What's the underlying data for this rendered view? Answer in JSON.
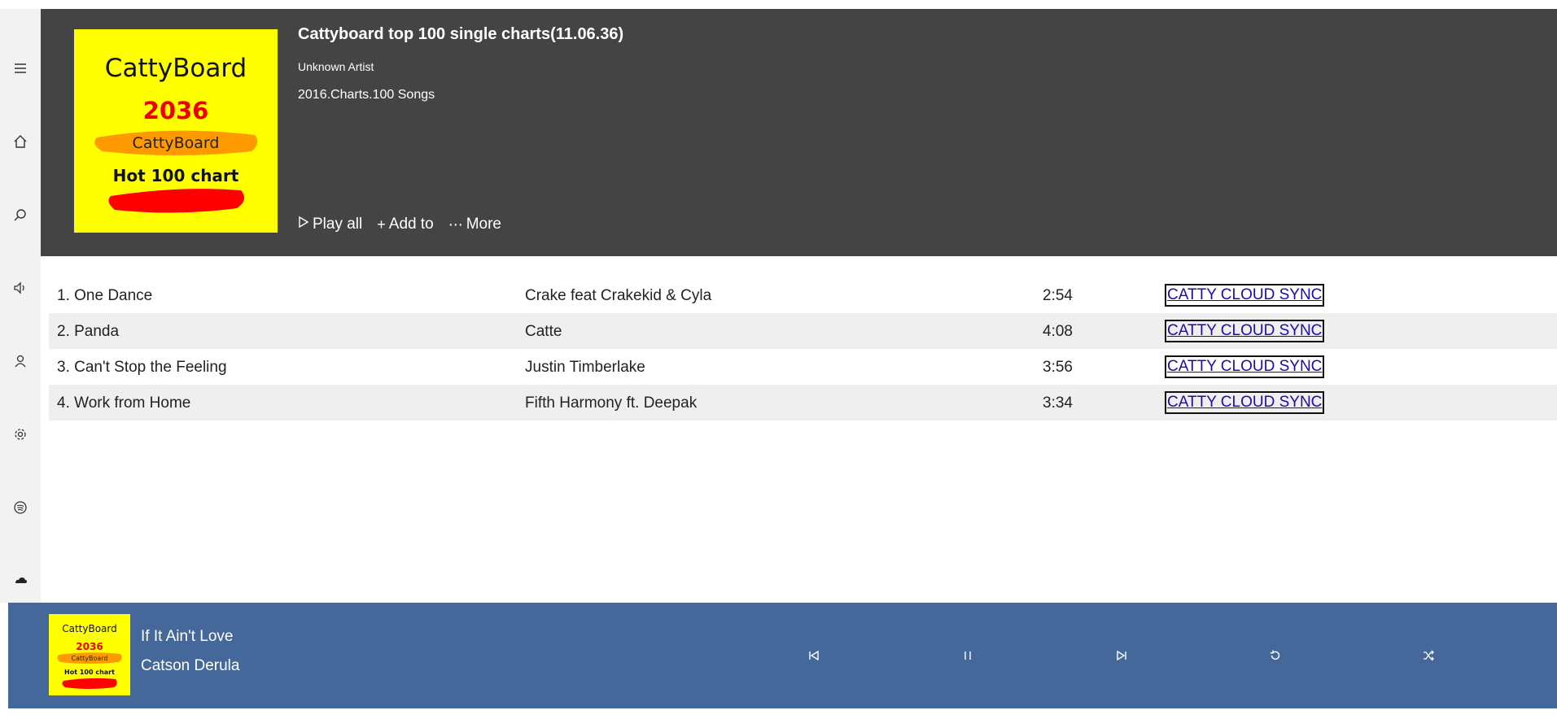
{
  "sidebar": {
    "items": [
      {
        "name": "menu-icon"
      },
      {
        "name": "home-icon"
      },
      {
        "name": "search-icon"
      },
      {
        "name": "speaker-icon"
      },
      {
        "name": "user-icon"
      },
      {
        "name": "gear-icon"
      },
      {
        "name": "spotify-icon"
      },
      {
        "name": "soundcloud-icon"
      }
    ]
  },
  "album": {
    "title": "Cattyboard top 100 single charts(11.06.36)",
    "artist": "Unknown Artist",
    "subtitle": "2016.Charts.100 Songs",
    "art": {
      "brand": "CattyBoard",
      "year": "2036",
      "brand2": "CattyBoard",
      "label": "Hot 100 chart"
    },
    "actions": {
      "play_all": "Play all",
      "add_to": "Add to",
      "more": "More"
    }
  },
  "tracks": [
    {
      "title": "1. One Dance",
      "artist": "Crake feat Crakekid & Cyla",
      "duration": "2:54",
      "sync": "CATTY CLOUD SYNC"
    },
    {
      "title": "2. Panda",
      "artist": "Catte",
      "duration": "4:08",
      "sync": "CATTY CLOUD SYNC"
    },
    {
      "title": "3. Can't Stop the Feeling",
      "artist": "Justin Timberlake",
      "duration": "3:56",
      "sync": "CATTY CLOUD SYNC"
    },
    {
      "title": "4. Work from Home",
      "artist": "Fifth Harmony ft. Deepak",
      "duration": "3:34",
      "sync": "CATTY CLOUD SYNC"
    }
  ],
  "player": {
    "now_title": "If It Ain't Love",
    "now_artist": "Catson Derula",
    "art": {
      "brand": "CattyBoard",
      "year": "2036",
      "brand2": "CattyBoard",
      "label": "Hot 100 chart"
    },
    "controls": [
      "previous-icon",
      "pause-icon",
      "next-icon",
      "repeat-icon",
      "shuffle-icon"
    ]
  },
  "colors": {
    "header_bg": "#444444",
    "player_bg": "#44689a",
    "sidebar_bg": "#f2f2f2",
    "row_alt": "#efefef",
    "link": "#1a0dab",
    "art_yellow": "#ffff00",
    "art_red": "#ff0000",
    "art_orange": "#ff9900"
  }
}
